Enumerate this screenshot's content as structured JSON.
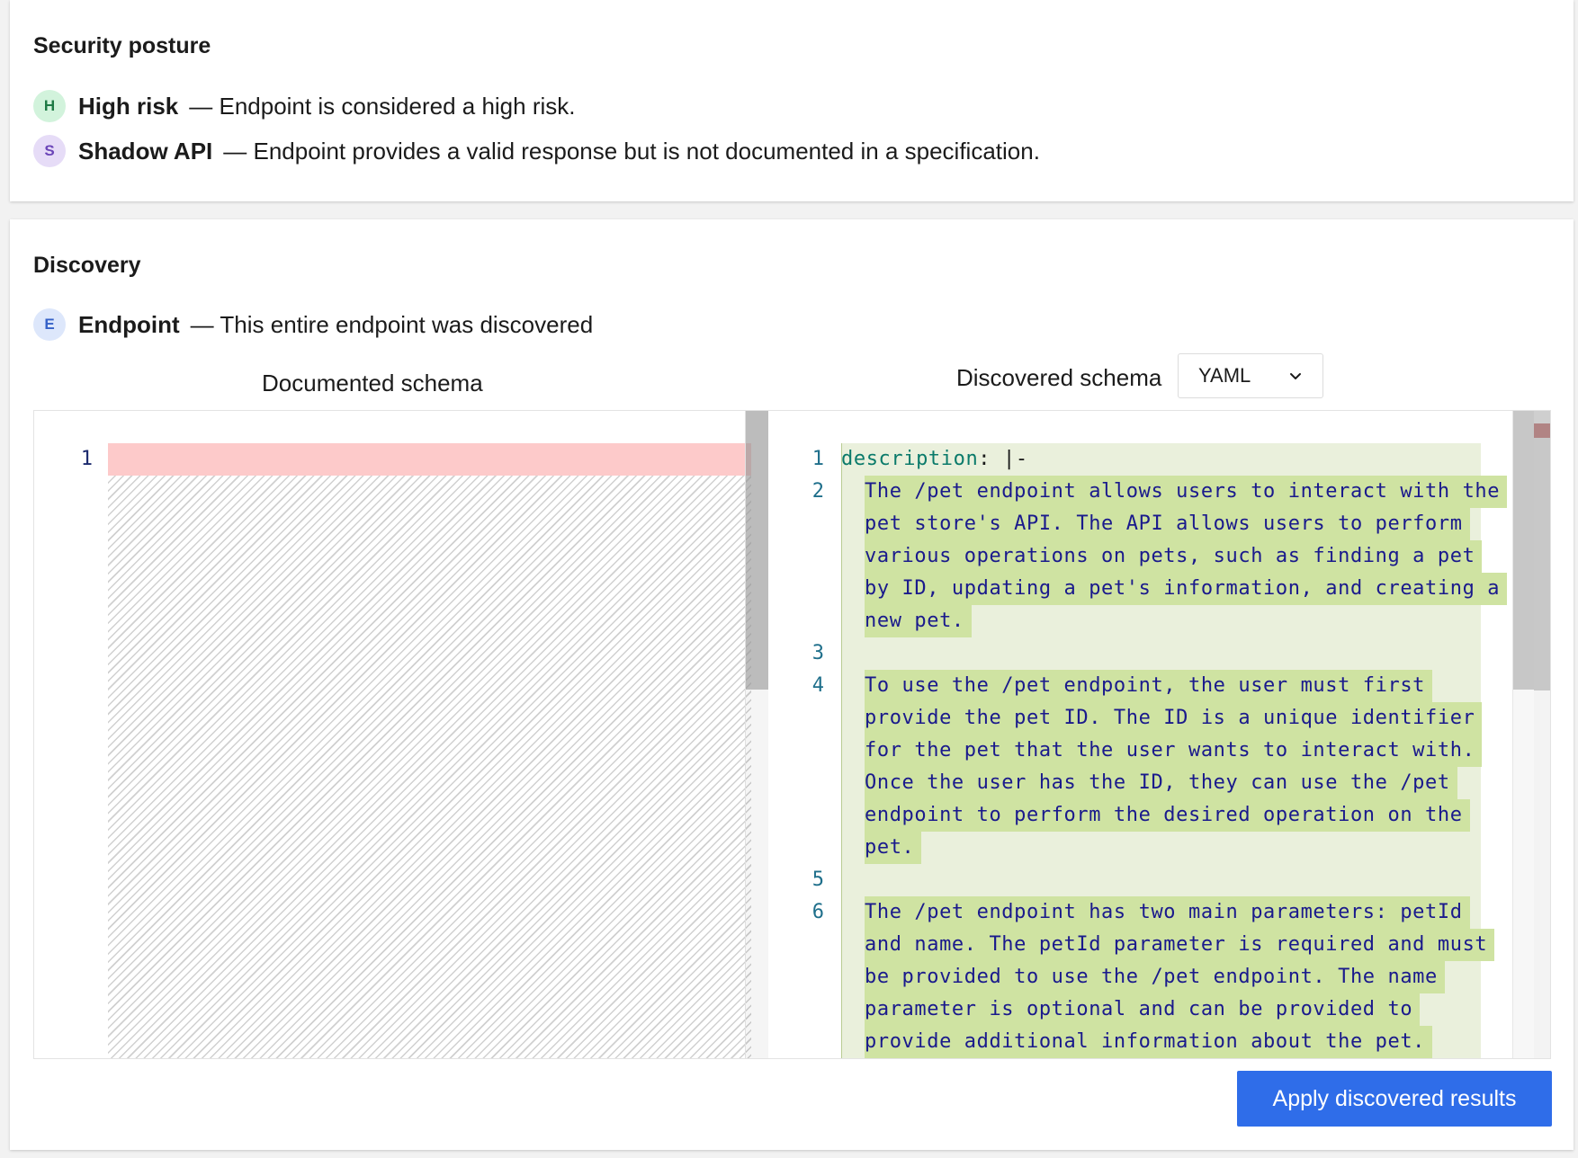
{
  "security": {
    "title": "Security posture",
    "items": [
      {
        "badge": "H",
        "name": "High risk",
        "description": "— Endpoint is considered a high risk."
      },
      {
        "badge": "S",
        "name": "Shadow API",
        "description": "— Endpoint provides a valid response but is not documented in a specification."
      }
    ]
  },
  "discovery": {
    "title": "Discovery",
    "item": {
      "badge": "E",
      "name": "Endpoint",
      "description": "— This entire endpoint was discovered"
    },
    "documented_heading": "Documented schema",
    "discovered_heading": "Discovered schema",
    "format_select": {
      "value": "YAML",
      "icon": "chevron-down-icon"
    },
    "left_editor": {
      "line_numbers": [
        "1"
      ]
    },
    "right_editor": {
      "key": "description",
      "key_suffix": ": |-",
      "lines": [
        {
          "num": "1",
          "wrapped": []
        },
        {
          "num": "2",
          "wrapped": [
            "The /pet endpoint allows users to interact with the",
            "pet store's API. The API allows users to perform",
            "various operations on pets, such as finding a pet",
            "by ID, updating a pet's information, and creating a",
            "new pet."
          ]
        },
        {
          "num": "3",
          "wrapped": []
        },
        {
          "num": "4",
          "wrapped": [
            "To use the /pet endpoint, the user must first",
            "provide the pet ID. The ID is a unique identifier",
            "for the pet that the user wants to interact with.",
            "Once the user has the ID, they can use the /pet",
            "endpoint to perform the desired operation on the",
            "pet."
          ]
        },
        {
          "num": "5",
          "wrapped": []
        },
        {
          "num": "6",
          "wrapped": [
            "The /pet endpoint has two main parameters: petId",
            "and name. The petId parameter is required and must",
            "be provided to use the /pet endpoint. The name",
            "parameter is optional and can be provided to",
            "provide additional information about the pet."
          ]
        }
      ]
    },
    "apply_label": "Apply discovered results"
  },
  "colors": {
    "accent": "#2f6de9",
    "removed_line": "#fdcaca",
    "added_bg": "#eaf0dc",
    "added_highlight": "#cfe3a2"
  }
}
